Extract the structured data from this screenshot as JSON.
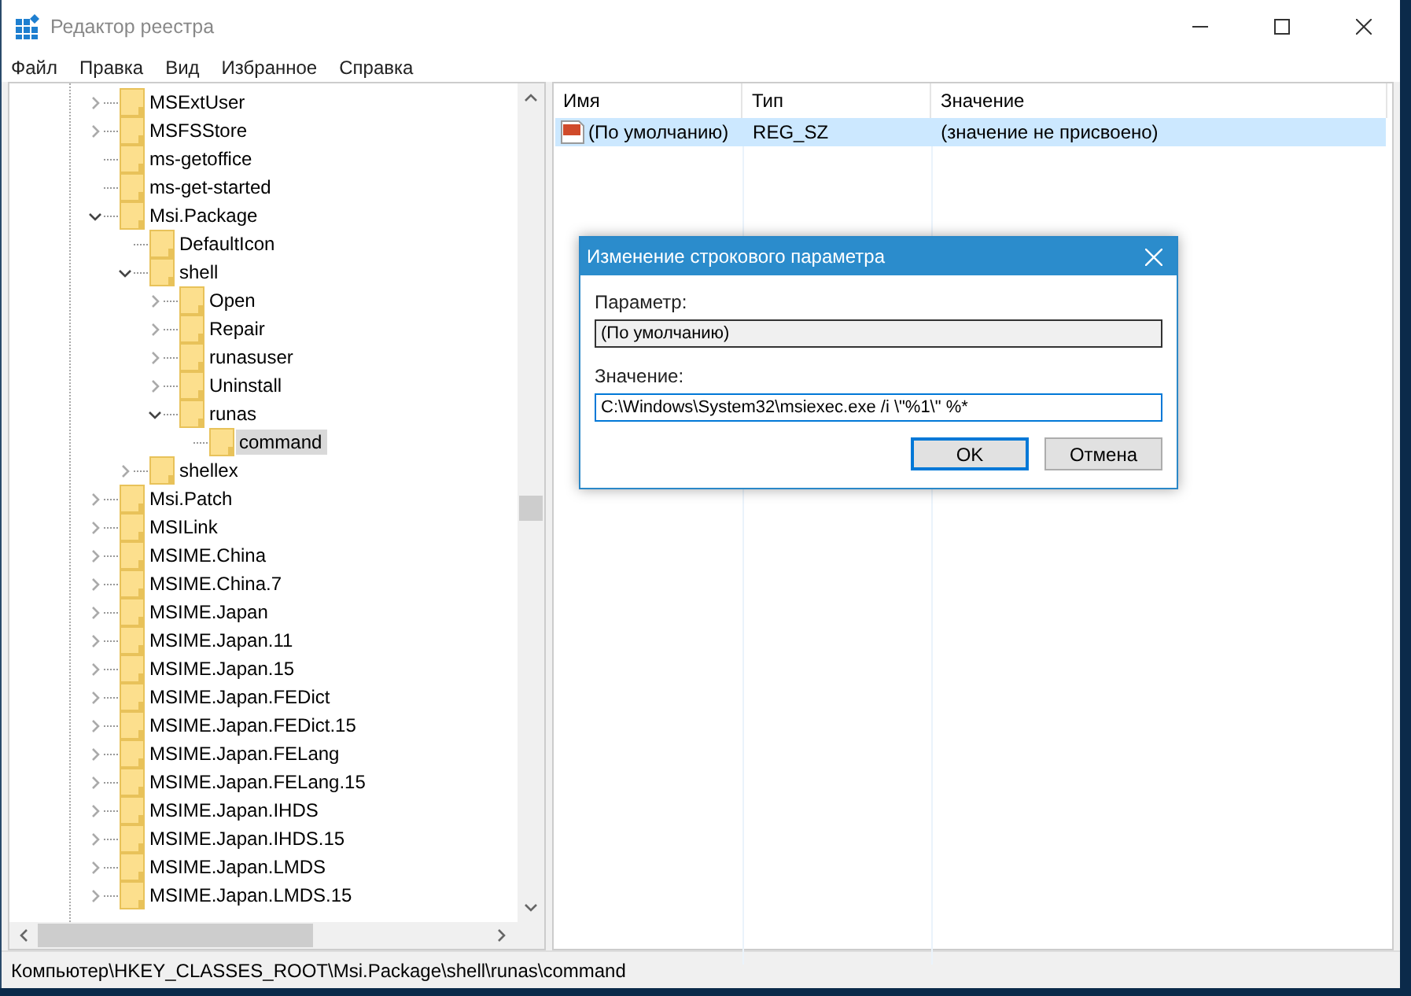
{
  "window": {
    "title": "Редактор реестра"
  },
  "menu": [
    "Файл",
    "Правка",
    "Вид",
    "Избранное",
    "Справка"
  ],
  "tree": [
    {
      "name": "MSExtUser",
      "expanded": false,
      "selected": false
    },
    {
      "name": "MSFSStore",
      "expanded": false,
      "selected": false
    },
    {
      "name": "ms-getoffice",
      "selected": false
    },
    {
      "name": "ms-get-started",
      "selected": false
    },
    {
      "name": "Msi.Package",
      "expanded": true,
      "selected": false,
      "children": [
        {
          "name": "DefaultIcon",
          "selected": false
        },
        {
          "name": "shell",
          "expanded": true,
          "selected": false,
          "children": [
            {
              "name": "Open",
              "expanded": false,
              "selected": false
            },
            {
              "name": "Repair",
              "expanded": false,
              "selected": false
            },
            {
              "name": "runasuser",
              "expanded": false,
              "selected": false
            },
            {
              "name": "Uninstall",
              "expanded": false,
              "selected": false
            },
            {
              "name": "runas",
              "expanded": true,
              "selected": false,
              "children": [
                {
                  "name": "command",
                  "selected": true
                }
              ]
            }
          ]
        },
        {
          "name": "shellex",
          "expanded": false,
          "selected": false
        }
      ]
    },
    {
      "name": "Msi.Patch",
      "expanded": false,
      "selected": false
    },
    {
      "name": "MSILink",
      "expanded": false,
      "selected": false
    },
    {
      "name": "MSIME.China",
      "expanded": false,
      "selected": false
    },
    {
      "name": "MSIME.China.7",
      "expanded": false,
      "selected": false
    },
    {
      "name": "MSIME.Japan",
      "expanded": false,
      "selected": false
    },
    {
      "name": "MSIME.Japan.11",
      "expanded": false,
      "selected": false
    },
    {
      "name": "MSIME.Japan.15",
      "expanded": false,
      "selected": false
    },
    {
      "name": "MSIME.Japan.FEDict",
      "expanded": false,
      "selected": false
    },
    {
      "name": "MSIME.Japan.FEDict.15",
      "expanded": false,
      "selected": false
    },
    {
      "name": "MSIME.Japan.FELang",
      "expanded": false,
      "selected": false
    },
    {
      "name": "MSIME.Japan.FELang.15",
      "expanded": false,
      "selected": false
    },
    {
      "name": "MSIME.Japan.IHDS",
      "expanded": false,
      "selected": false
    },
    {
      "name": "MSIME.Japan.IHDS.15",
      "expanded": false,
      "selected": false
    },
    {
      "name": "MSIME.Japan.LMDS",
      "expanded": false,
      "selected": false
    },
    {
      "name": "MSIME.Japan.LMDS.15",
      "expanded": false,
      "selected": false
    }
  ],
  "table": {
    "columns": [
      "Имя",
      "Тип",
      "Значение"
    ],
    "rows": [
      {
        "name": "(По умолчанию)",
        "type": "REG_SZ",
        "value": "(значение не присвоено)",
        "selected": true
      }
    ]
  },
  "dialog": {
    "title": "Изменение строкового параметра",
    "param_label": "Параметр:",
    "param_value": "(По умолчанию)",
    "value_label": "Значение:",
    "value": "C:\\Windows\\System32\\msiexec.exe /i \\\"%1\\\" %*",
    "buttons": [
      "OK",
      "Отмена"
    ]
  },
  "status_bar": "Компьютер\\HKEY_CLASSES_ROOT\\Msi.Package\\shell\\runas\\command"
}
